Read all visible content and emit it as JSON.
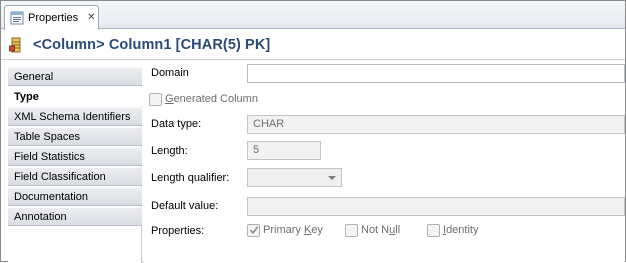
{
  "tab": {
    "label": "Properties",
    "close": "✕"
  },
  "header": {
    "title": "<Column> Column1 [CHAR(5) PK]"
  },
  "sidebar": {
    "items": [
      {
        "label": "General",
        "selected": false
      },
      {
        "label": "Type",
        "selected": true
      },
      {
        "label": "XML Schema Identifiers",
        "selected": false
      },
      {
        "label": "Table Spaces",
        "selected": false
      },
      {
        "label": "Field Statistics",
        "selected": false
      },
      {
        "label": "Field Classification",
        "selected": false
      },
      {
        "label": "Documentation",
        "selected": false
      },
      {
        "label": "Annotation",
        "selected": false
      }
    ]
  },
  "form": {
    "domain": {
      "label": "Domain",
      "value": ""
    },
    "generated_column": {
      "mnemonic": "G",
      "rest": "enerated Column",
      "checked": false
    },
    "data_type": {
      "label": "Data type:",
      "value": "CHAR"
    },
    "length": {
      "label": "Length:",
      "value": "5"
    },
    "length_qualifier": {
      "label": "Length qualifier:",
      "value": ""
    },
    "default_value": {
      "label": "Default value:",
      "value": ""
    },
    "properties": {
      "label": "Properties:",
      "primary_key": {
        "pre": "Primary ",
        "mnemonic": "K",
        "post": "ey",
        "checked": true
      },
      "not_null": {
        "pre": "Not N",
        "mnemonic": "u",
        "post": "ll",
        "checked": false
      },
      "identity": {
        "pre": "",
        "mnemonic": "I",
        "post": "dentity",
        "checked": false
      }
    }
  },
  "icons": {
    "tab": "properties-icon",
    "header": "column-icon"
  },
  "colors": {
    "title": "#2a4a78",
    "tab_border": "#a0abb9",
    "sidebar_bg": "#e1e4e9"
  }
}
